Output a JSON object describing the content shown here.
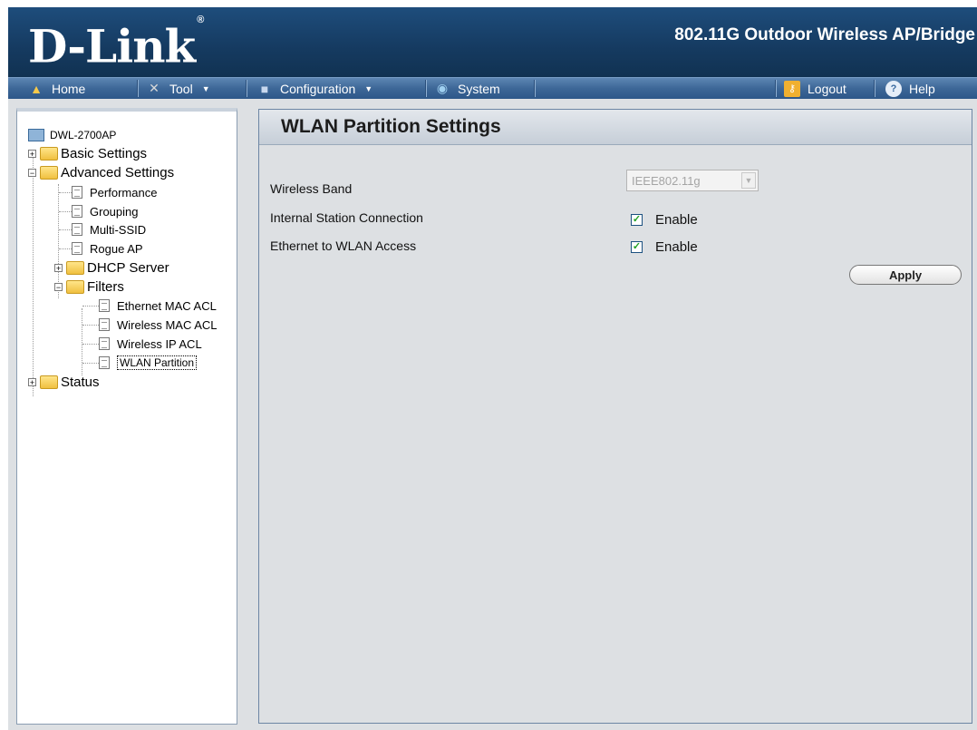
{
  "header": {
    "logo_text": "D-Link",
    "logo_mark": "®",
    "product_title": "802.11G Outdoor Wireless AP/Bridge"
  },
  "menubar": {
    "home": {
      "label": "Home",
      "icon": "home-icon"
    },
    "tool": {
      "label": "Tool",
      "icon": "tool-icon"
    },
    "configuration": {
      "label": "Configuration",
      "icon": "save-disk-icon"
    },
    "system": {
      "label": "System",
      "icon": "system-icon"
    },
    "logout": {
      "label": "Logout",
      "icon": "key-icon"
    },
    "help": {
      "label": "Help",
      "icon": "help-icon"
    }
  },
  "tree": {
    "root": "DWL-2700AP",
    "basic": "Basic Settings",
    "advanced": "Advanced Settings",
    "performance": "Performance",
    "grouping": "Grouping",
    "multissid": "Multi-SSID",
    "rogue": "Rogue AP",
    "dhcp": "DHCP Server",
    "filters": "Filters",
    "eth_acl": "Ethernet MAC ACL",
    "wl_acl": "Wireless MAC ACL",
    "wl_ip": "Wireless IP ACL",
    "wlan_part": "WLAN Partition",
    "status": "Status"
  },
  "main": {
    "title": "WLAN Partition Settings",
    "wireless_band_label": "Wireless Band",
    "wireless_band_value": "IEEE802.11g",
    "internal_station_label": "Internal Station Connection",
    "internal_station_option": "Enable",
    "internal_station_checked": true,
    "eth_wlan_label": "Ethernet to WLAN Access",
    "eth_wlan_option": "Enable",
    "eth_wlan_checked": true,
    "apply_label": "Apply"
  }
}
